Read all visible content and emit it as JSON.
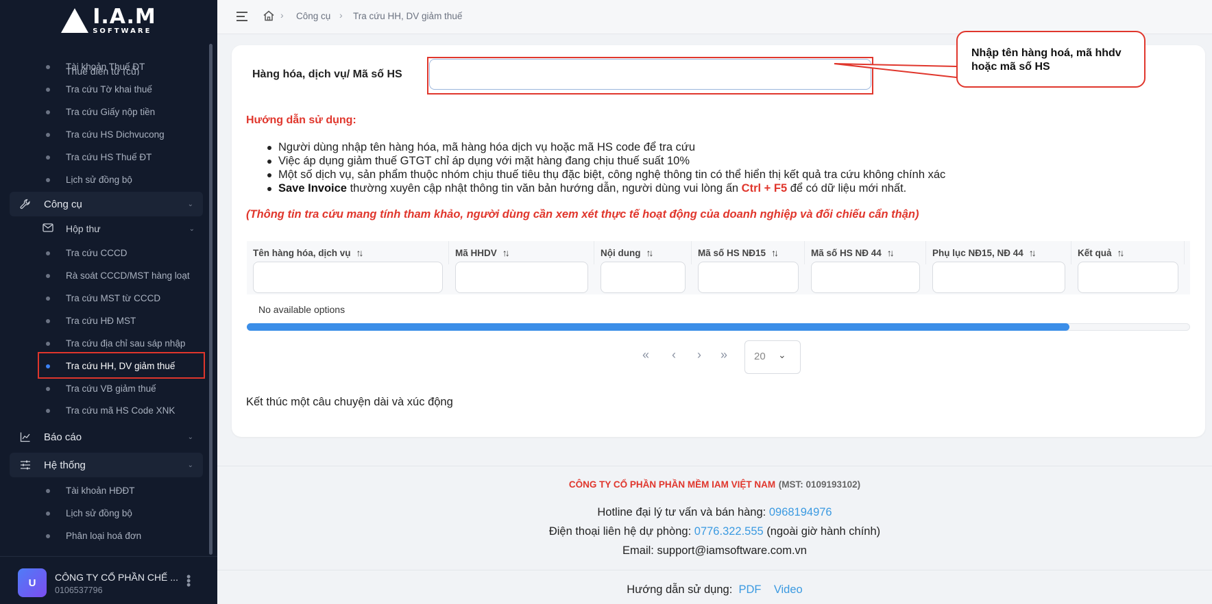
{
  "brand": {
    "logo_main": "I.A.M",
    "logo_sub": "SOFTWARE"
  },
  "sidebar": {
    "partial_top": "Thuế điện tử (cũ)",
    "group1_items": [
      "Tài khoản Thuế ĐT",
      "Tra cứu Tờ khai thuế",
      "Tra cứu Giấy nộp tiền",
      "Tra cứu HS Dichvucong",
      "Tra cứu HS Thuế ĐT",
      "Lịch sử đồng bộ"
    ],
    "tools_group": "Công cụ",
    "inbox_sub": "Hộp thư",
    "tools_items": [
      "Tra cứu CCCD",
      "Rà soát CCCD/MST hàng loạt",
      "Tra cứu MST từ CCCD",
      "Tra cứu HĐ MST",
      "Tra cứu địa chỉ sau sáp nhập",
      "Tra cứu HH, DV giảm thuế",
      "Tra cứu VB giảm thuế",
      "Tra cứu mã HS Code XNK"
    ],
    "report_group": "Báo cáo",
    "system_group": "Hệ thống",
    "system_items": [
      "Tài khoản HĐĐT",
      "Lịch sử đồng bộ",
      "Phân loại hoá đơn"
    ]
  },
  "user": {
    "initial": "U",
    "name": "CÔNG TY CỔ PHẦN CHẾ ...",
    "mst": "0106537796"
  },
  "breadcrumb": {
    "level1": "Công cụ",
    "level2": "Tra cứu HH, DV giảm thuế"
  },
  "search": {
    "label": "Hàng hóa, dịch vụ/ Mã số HS",
    "value": "",
    "placeholder": ""
  },
  "callout": {
    "text": "Nhập tên hàng hoá, mã hhdv hoặc mã số HS"
  },
  "guide": {
    "title": "Hướng dẫn sử dụng:",
    "items": [
      "Người dùng nhập tên hàng hóa, mã hàng hóa dịch vụ hoặc mã HS code để tra cứu",
      "Việc áp dụng giảm thuế GTGT chỉ áp dụng với mặt hàng đang chịu thuế suất 10%",
      "Một số dịch vụ, sản phẩm thuộc nhóm chịu thuế tiêu thụ đặc biệt, công nghệ thông tin có thể hiển thị kết quả tra cứu không chính xác"
    ],
    "item4_bold": "Save Invoice",
    "item4_mid": " thường xuyên cập nhật thông tin văn bản hướng dẫn, người dùng vui lòng ấn ",
    "item4_key": "Ctrl + F5",
    "item4_end": " để có dữ liệu mới nhất.",
    "note": "(Thông tin tra cứu mang tính tham khảo, người dùng cần xem xét thực tế hoạt động của doanh nghiệp và đối chiếu cẩn thận)"
  },
  "table": {
    "columns": [
      "Tên hàng hóa, dịch vụ",
      "Mã HHDV",
      "Nội dung",
      "Mã số HS NĐ15",
      "Mã số HS NĐ 44",
      "Phụ lục NĐ15, NĐ 44",
      "Kết quả"
    ],
    "empty_text": "No available options"
  },
  "pagination": {
    "first": "«",
    "prev": "‹",
    "next": "›",
    "last": "»",
    "page_size": "20"
  },
  "closing_text": "Kết thúc một câu chuyện dài và xúc động",
  "footer": {
    "company": "CÔNG TY CỔ PHẦN PHẦN MỀM IAM VIỆT NAM",
    "mst": "(MST: 0109193102)",
    "hotline_label": "Hotline đại lý tư vấn và bán hàng:",
    "hotline": "0968194976",
    "backup_label": "Điện thoại liên hệ dự phòng:",
    "backup": "0776.322.555",
    "backup_note": "(ngoài giờ hành chính)",
    "email_label": "Email:",
    "email": "support@iamsoftware.com.vn",
    "guide_label": "Hướng dẫn sử dụng:",
    "pdf": "PDF",
    "video": "Video"
  },
  "colors": {
    "accent_red": "#e0362c",
    "link_blue": "#3b9ae1",
    "sidebar_bg": "#121a2b",
    "progress_blue": "#3b8ee8"
  },
  "icons": {
    "menu": "hamburger-icon",
    "home": "home-icon",
    "tools": "wrench-icon",
    "inbox": "mail-icon",
    "report": "chart-line-icon",
    "system": "sliders-icon"
  }
}
